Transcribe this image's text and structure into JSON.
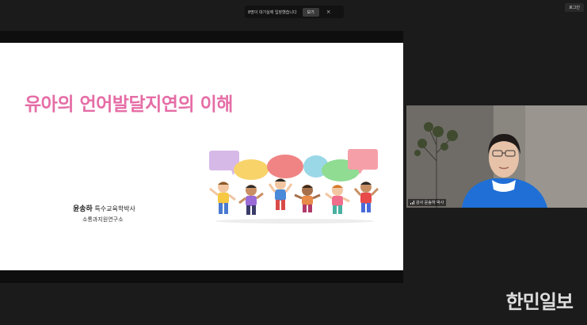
{
  "notification": {
    "message": "8명이 대기실에 입장했습니다",
    "view_label": "보기",
    "close_glyph": "×"
  },
  "header": {
    "login_label": "로그인"
  },
  "slide": {
    "title": "유아의 언어발달지연의 이해",
    "presenter_name": "윤송하",
    "presenter_title": "특수교육학박사",
    "organization": "소통과지원연구소"
  },
  "video": {
    "name_label": "강사 윤송하 박사"
  },
  "watermark": "한민일보",
  "colors": {
    "title": "#e56da6",
    "background": "#1b1b1b",
    "jacket": "#1f6fd6"
  }
}
